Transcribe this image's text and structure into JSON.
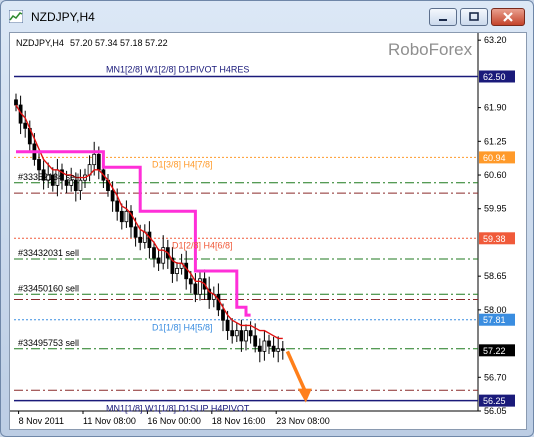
{
  "window": {
    "title": "NZDJPY,H4",
    "buttons": [
      "minimize",
      "maximize",
      "close"
    ]
  },
  "chart_header": {
    "symbol": "NZDJPY,H4",
    "ohlc": "57.20 57.34 57.18 57.22"
  },
  "watermark": "RoboForex",
  "chart_data": {
    "type": "candlestick",
    "symbol": "NZDJPY",
    "timeframe": "H4",
    "ylim": [
      56.05,
      63.3
    ],
    "y_ticks": [
      "63.20",
      "61.90",
      "61.25",
      "60.60",
      "59.95",
      "58.65",
      "58.00",
      "56.70",
      "56.05"
    ],
    "x_ticks": [
      "8 Nov 2011",
      "11 Nov 08:00",
      "16 Nov 00:00",
      "18 Nov 16:00",
      "23 Nov 08:00"
    ],
    "price_tags": [
      {
        "text": "62.50",
        "value": 62.5,
        "bg": "#1a1a7a",
        "fg": "#ffffff"
      },
      {
        "text": "60.94",
        "value": 60.94,
        "bg": "#ff9a2a",
        "fg": "#ffffff"
      },
      {
        "text": "59.38",
        "value": 59.38,
        "bg": "#f05a3a",
        "fg": "#ffffff"
      },
      {
        "text": "57.81",
        "value": 57.81,
        "bg": "#3a8de0",
        "fg": "#ffffff"
      },
      {
        "text": "57.22",
        "value": 57.22,
        "bg": "#000000",
        "fg": "#ffffff"
      },
      {
        "text": "56.25",
        "value": 56.25,
        "bg": "#1a1a7a",
        "fg": "#ffffff"
      }
    ],
    "levels": [
      {
        "label": "MN1[2/8] W1[2/8] D1PIVOT H4RES",
        "value": 62.5,
        "color": "#1a1a7a",
        "style": "solid"
      },
      {
        "label": "D1[3/8] H4[7/8]",
        "value": 60.94,
        "color": "#ff9a2a",
        "style": "dotted"
      },
      {
        "label": "D1[2/8] H4[6/8]",
        "value": 59.38,
        "color": "#f05a3a",
        "style": "dotted"
      },
      {
        "label": "D1[1/8] H4[5/8]",
        "value": 57.81,
        "color": "#3a8de0",
        "style": "dotted"
      },
      {
        "label": "MN1[1/8] W1[1/8] D1SUP H4PIVOT",
        "value": 56.25,
        "color": "#1a1a7a",
        "style": "solid"
      }
    ],
    "orders": [
      {
        "label": "#33352134 sell",
        "value": 60.45
      },
      {
        "label": "#33432031 sell",
        "value": 58.98
      },
      {
        "label": "#33450160 sell",
        "value": 58.3
      },
      {
        "label": "#33495753 sell",
        "value": 57.25
      }
    ],
    "extra_dashed_levels": [
      60.25,
      58.2,
      56.45
    ],
    "close": [
      61.95,
      61.6,
      61.5,
      61.2,
      60.9,
      60.7,
      60.5,
      60.6,
      60.4,
      60.7,
      60.5,
      60.4,
      60.5,
      60.3,
      60.5,
      60.6,
      60.8,
      61.0,
      60.7,
      60.5,
      60.3,
      60.1,
      59.9,
      59.7,
      59.9,
      59.6,
      59.4,
      59.3,
      59.5,
      59.2,
      59.0,
      58.9,
      59.2,
      59.0,
      58.7,
      58.8,
      58.9,
      58.6,
      58.5,
      58.3,
      58.6,
      58.4,
      58.2,
      58.3,
      58.0,
      57.8,
      57.6,
      57.5,
      57.6,
      57.4,
      57.6,
      57.5,
      57.3,
      57.2,
      57.4,
      57.3,
      57.2,
      57.25,
      57.22
    ],
    "ma_red": [
      61.95,
      61.8,
      61.7,
      61.5,
      61.3,
      61.1,
      60.9,
      60.8,
      60.7,
      60.7,
      60.65,
      60.6,
      60.6,
      60.55,
      60.55,
      60.55,
      60.6,
      60.7,
      60.7,
      60.6,
      60.5,
      60.35,
      60.2,
      60.0,
      59.95,
      59.85,
      59.7,
      59.55,
      59.5,
      59.4,
      59.3,
      59.15,
      59.15,
      59.1,
      58.95,
      58.9,
      58.9,
      58.8,
      58.7,
      58.55,
      58.55,
      58.5,
      58.35,
      58.3,
      58.2,
      58.05,
      57.9,
      57.8,
      57.75,
      57.7,
      57.7,
      57.7,
      57.65,
      57.6,
      57.6,
      57.55,
      57.5,
      57.45,
      57.45
    ],
    "step_magenta": [
      [
        0,
        61.05
      ],
      [
        19,
        61.05
      ],
      [
        19,
        60.75
      ],
      [
        27,
        60.75
      ],
      [
        27,
        59.9
      ],
      [
        39,
        59.9
      ],
      [
        39,
        58.75
      ],
      [
        48,
        58.75
      ],
      [
        48,
        58.05
      ],
      [
        50,
        58.05
      ],
      [
        50,
        57.9
      ],
      [
        51,
        57.9
      ]
    ],
    "forecast_arrow": {
      "from": [
        57.2,
        59
      ],
      "to": [
        56.25,
        63
      ],
      "color": "#ff7f1a"
    }
  }
}
